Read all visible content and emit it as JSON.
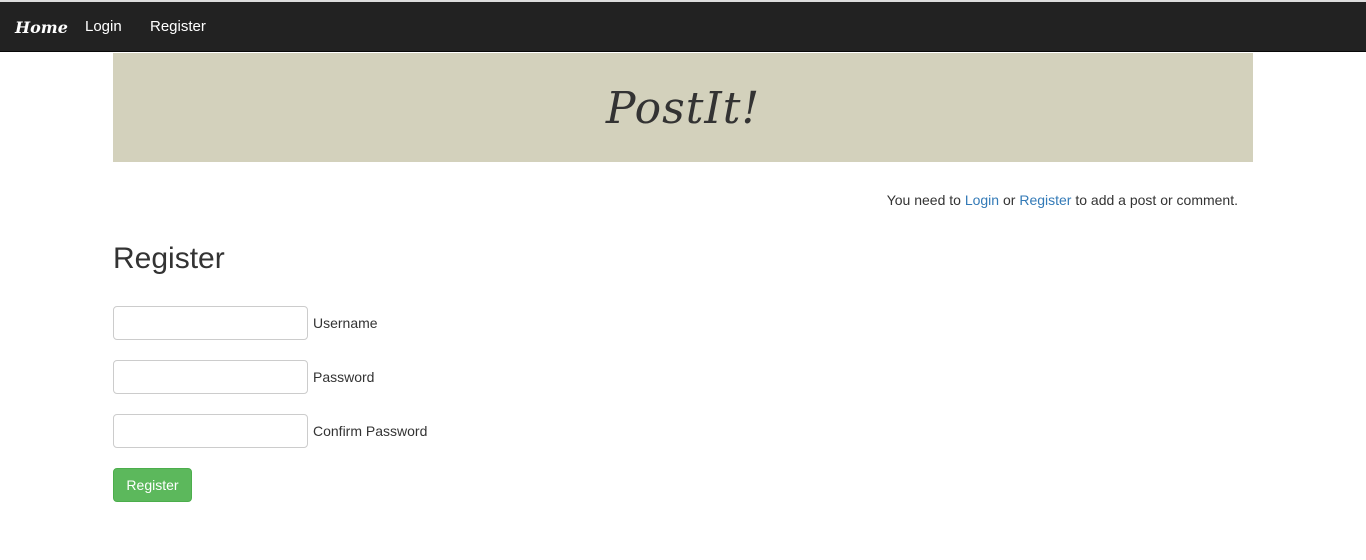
{
  "nav": {
    "brand": "Home",
    "login": "Login",
    "register": "Register"
  },
  "banner": {
    "logo": "PostIt!"
  },
  "notice": {
    "pre": "You need to ",
    "login": "Login",
    "mid": " or ",
    "register": "Register",
    "post": " to add a post or comment."
  },
  "form": {
    "title": "Register",
    "fields": [
      {
        "label": "Username",
        "value": ""
      },
      {
        "label": "Password",
        "value": ""
      },
      {
        "label": "Confirm Password",
        "value": ""
      }
    ],
    "submit": "Register"
  }
}
